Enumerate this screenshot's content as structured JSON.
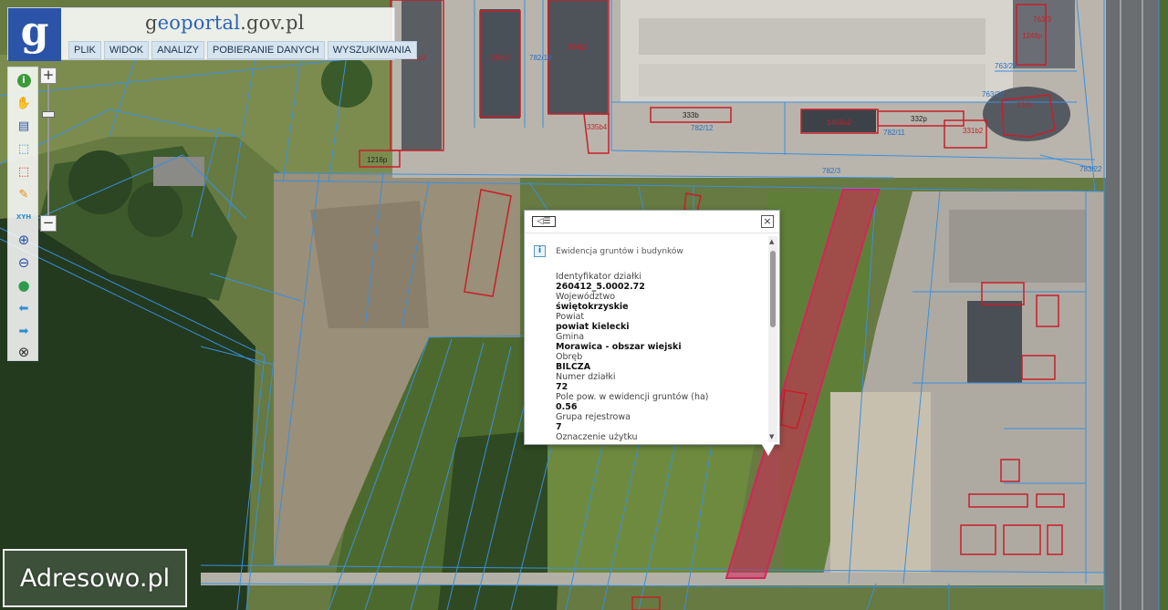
{
  "app": {
    "logo_letter": "g",
    "brand_prefix": "g",
    "brand_main": "eoportal",
    "brand_suffix": ".gov.pl"
  },
  "menu": [
    {
      "label": "PLIK"
    },
    {
      "label": "WIDOK"
    },
    {
      "label": "ANALIZY"
    },
    {
      "label": "POBIERANIE DANYCH"
    },
    {
      "label": "WYSZUKIWANIA"
    }
  ],
  "toolbar": [
    {
      "icon": "info-icon",
      "glyph": "i",
      "color": "#3c9a3c"
    },
    {
      "icon": "pan-hand-icon",
      "glyph": "✋",
      "color": "#d79a4a"
    },
    {
      "icon": "legend-icon",
      "glyph": "▤",
      "color": "#2b54a8"
    },
    {
      "icon": "select-icon",
      "glyph": "⬚",
      "color": "#2b8fd6"
    },
    {
      "icon": "select-area-icon",
      "glyph": "⬚",
      "color": "#d43030"
    },
    {
      "icon": "draw-icon",
      "glyph": "✎",
      "color": "#e08a1a"
    },
    {
      "icon": "xyh-coordinates-icon",
      "glyph": "XYH",
      "color": "#2b8fd6"
    },
    {
      "icon": "zoom-in-icon",
      "glyph": "⊕",
      "color": "#2b54a8"
    },
    {
      "icon": "zoom-out-icon",
      "glyph": "⊖",
      "color": "#2b54a8"
    },
    {
      "icon": "globe-icon",
      "glyph": "●",
      "color": "#2e9a4e"
    },
    {
      "icon": "back-arrow-icon",
      "glyph": "⬅",
      "color": "#2b8fd6"
    },
    {
      "icon": "forward-arrow-icon",
      "glyph": "➡",
      "color": "#2b8fd6"
    },
    {
      "icon": "clear-icon",
      "glyph": "⊗",
      "color": "#333333"
    }
  ],
  "zoom": {
    "plus": "+",
    "minus": "−"
  },
  "popup": {
    "back_glyph": "◁☰",
    "close_glyph": "×",
    "section_icon": "i",
    "section_title": "Ewidencja gruntów i budynków",
    "fields": [
      {
        "label": "Identyfikator działki",
        "value": "260412_5.0002.72"
      },
      {
        "label": "Województwo",
        "value": "świętokrzyskie"
      },
      {
        "label": "Powiat",
        "value": "powiat kielecki"
      },
      {
        "label": "Gmina",
        "value": "Morawica - obszar wiejski"
      },
      {
        "label": "Obręb",
        "value": "BILCZA"
      },
      {
        "label": "Numer działki",
        "value": "72"
      },
      {
        "label": "Pole pow. w ewidencji gruntów (ha)",
        "value": "0.56"
      },
      {
        "label": "Grupa rejestrowa",
        "value": "7"
      },
      {
        "label": "Oznaczenie użytku",
        "value": ""
      }
    ]
  },
  "map_labels": [
    {
      "text": "331p2"
    },
    {
      "text": "338p2"
    },
    {
      "text": "782/10"
    },
    {
      "text": "334p2"
    },
    {
      "text": "335b4"
    },
    {
      "text": "1216p"
    },
    {
      "text": "333b"
    },
    {
      "text": "782/12"
    },
    {
      "text": "1469a2"
    },
    {
      "text": "332p"
    },
    {
      "text": "782/11"
    },
    {
      "text": "331b2"
    },
    {
      "text": "782/3"
    },
    {
      "text": "783/22"
    },
    {
      "text": "763/3"
    },
    {
      "text": "1248p"
    },
    {
      "text": "763/23"
    },
    {
      "text": "763/29"
    },
    {
      "text": "330h"
    }
  ],
  "watermark": "Adresowo.pl",
  "colors": {
    "parcel_line": "#3a8fe0",
    "building_outline": "#c81e2a",
    "selected_parcel": "#d6245a",
    "menu_bg": "#d6e4ef",
    "logo_bg": "#2b54a8"
  }
}
